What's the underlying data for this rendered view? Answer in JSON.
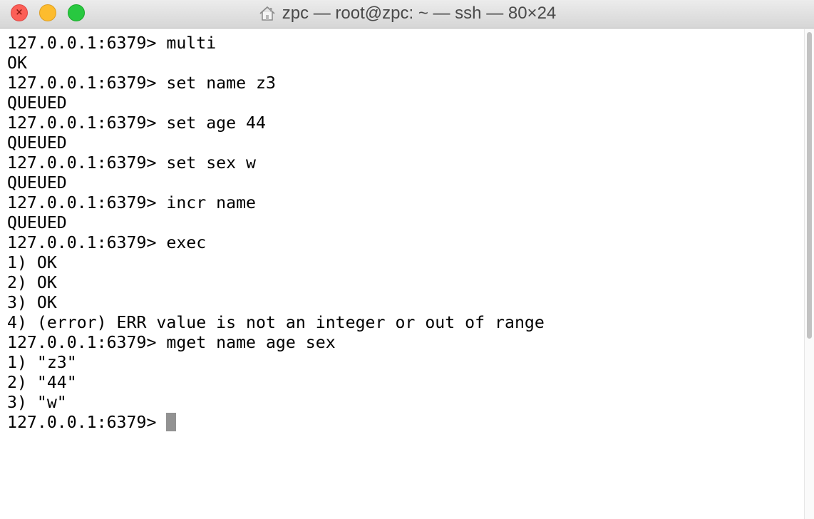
{
  "window": {
    "title": "zpc — root@zpc: ~ — ssh — 80×24",
    "title_icon": "home-icon",
    "controls": {
      "close_icon": "close-icon",
      "minimize_icon": "minimize-icon",
      "zoom_icon": "zoom-icon"
    },
    "colors": {
      "close": "#fc5f57",
      "minimize": "#fdbc2e",
      "zoom": "#28c840",
      "cursor": "#929292"
    }
  },
  "terminal": {
    "lines": [
      "127.0.0.1:6379> multi",
      "OK",
      "127.0.0.1:6379> set name z3",
      "QUEUED",
      "127.0.0.1:6379> set age 44",
      "QUEUED",
      "127.0.0.1:6379> set sex w",
      "QUEUED",
      "127.0.0.1:6379> incr name",
      "QUEUED",
      "127.0.0.1:6379> exec",
      "1) OK",
      "2) OK",
      "3) OK",
      "4) (error) ERR value is not an integer or out of range",
      "127.0.0.1:6379> mget name age sex",
      "1) \"z3\"",
      "2) \"44\"",
      "3) \"w\""
    ],
    "prompt": "127.0.0.1:6379> "
  }
}
